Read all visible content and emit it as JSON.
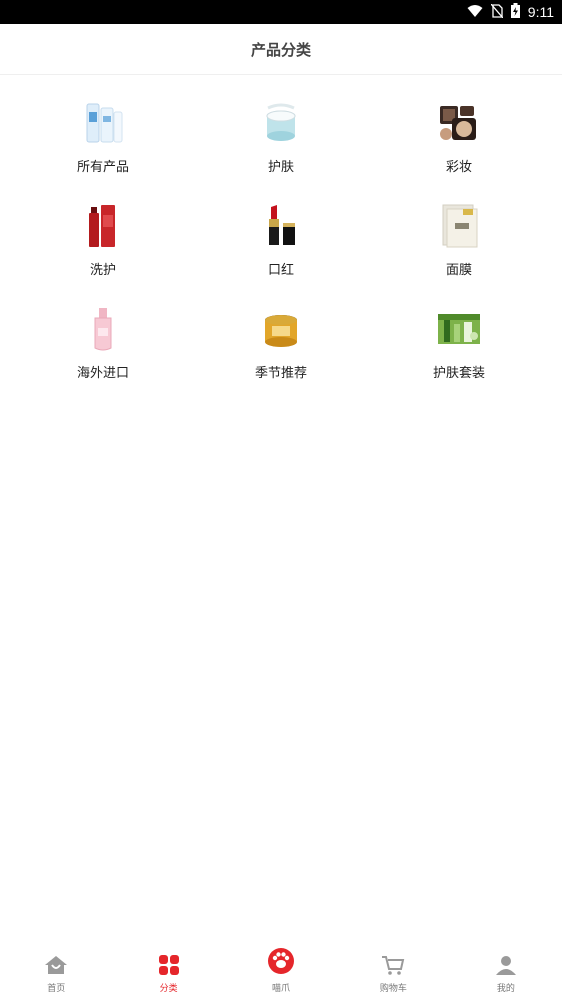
{
  "status_bar": {
    "time": "9:11",
    "icons": [
      "wifi-icon",
      "no-sim-icon",
      "battery-charging-icon"
    ]
  },
  "header": {
    "title": "产品分类"
  },
  "categories": [
    {
      "label": "所有产品",
      "icon": "cleanser-tubes-image"
    },
    {
      "label": "护肤",
      "icon": "cream-jar-image"
    },
    {
      "label": "彩妆",
      "icon": "compact-powder-image"
    },
    {
      "label": "洗护",
      "icon": "red-bottle-image"
    },
    {
      "label": "口红",
      "icon": "lipstick-image"
    },
    {
      "label": "面膜",
      "icon": "mask-pack-image"
    },
    {
      "label": "海外进口",
      "icon": "pink-toner-bottle-image"
    },
    {
      "label": "季节推荐",
      "icon": "honey-jar-image"
    },
    {
      "label": "护肤套装",
      "icon": "green-skincare-set-image"
    }
  ],
  "tabbar": {
    "items": [
      {
        "label": "首页",
        "icon": "home-icon",
        "active": false
      },
      {
        "label": "分类",
        "icon": "category-grid-icon",
        "active": true
      },
      {
        "label": "喵爪",
        "icon": "paw-icon",
        "active": false
      },
      {
        "label": "购物车",
        "icon": "cart-icon",
        "active": false
      },
      {
        "label": "我的",
        "icon": "user-icon",
        "active": false
      }
    ]
  },
  "colors": {
    "accent": "#e5262b",
    "inactive": "#8a8a8a",
    "title": "#444444"
  }
}
